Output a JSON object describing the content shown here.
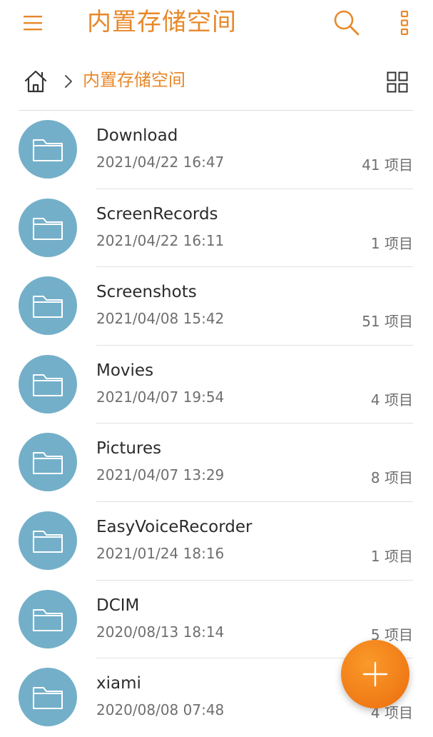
{
  "app": {
    "title": "内置存储空间",
    "accent_color": "#e8882a",
    "folder_color": "#74afc9"
  },
  "toolbar": {
    "menu_icon": "hamburger-menu-icon",
    "search_icon": "search-icon",
    "more_icon": "more-vertical-icon"
  },
  "breadcrumb": {
    "home_icon": "home-icon",
    "separator_icon": "chevron-right-icon",
    "current": "内置存储空间",
    "view_toggle_icon": "grid-view-icon"
  },
  "files": [
    {
      "name": "Download",
      "date": "2021/04/22 16:47",
      "count": "41 项目"
    },
    {
      "name": "ScreenRecords",
      "date": "2021/04/22 16:11",
      "count": "1 项目"
    },
    {
      "name": "Screenshots",
      "date": "2021/04/08 15:42",
      "count": "51 项目"
    },
    {
      "name": "Movies",
      "date": "2021/04/07 19:54",
      "count": "4 项目"
    },
    {
      "name": "Pictures",
      "date": "2021/04/07 13:29",
      "count": "8 项目"
    },
    {
      "name": "EasyVoiceRecorder",
      "date": "2021/01/24 18:16",
      "count": "1 项目"
    },
    {
      "name": "DCIM",
      "date": "2020/08/13 18:14",
      "count": "5 项目"
    },
    {
      "name": "xiami",
      "date": "2020/08/08 07:48",
      "count": "4 项目"
    }
  ],
  "fab": {
    "icon": "plus-icon"
  }
}
